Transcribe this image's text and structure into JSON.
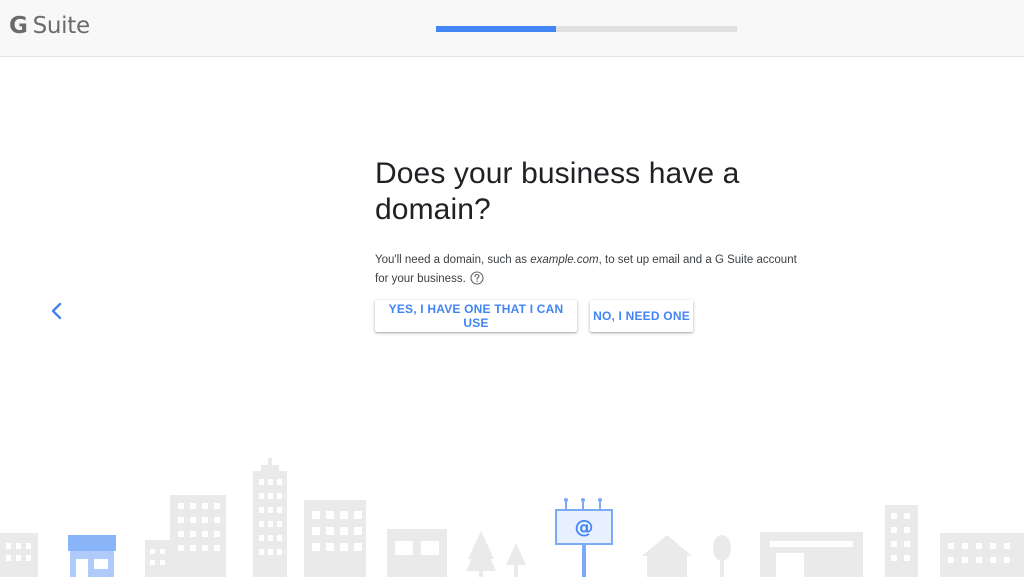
{
  "header": {
    "logo_letter": "G",
    "logo_word": "Suite",
    "progress_fraction": 0.4
  },
  "nav": {
    "back_icon": "chevron-left-icon"
  },
  "main": {
    "title": "Does your business have a domain?",
    "desc_before": "You'll need a domain, such as ",
    "desc_example": "example.com",
    "desc_after": ", to set up email and a G Suite account for your business.",
    "help_icon": "help-circle-icon",
    "yes_button": "YES, I HAVE ONE THAT I CAN USE",
    "no_button": "NO, I NEED ONE"
  },
  "illustration": {
    "billboard_symbol": "@"
  },
  "colors": {
    "accent": "#4285f4",
    "progress_track": "#e0e0e0",
    "building_gray": "#e9e9e9",
    "building_blue": "#aecbfa",
    "billboard_stroke": "#7baaf7"
  }
}
